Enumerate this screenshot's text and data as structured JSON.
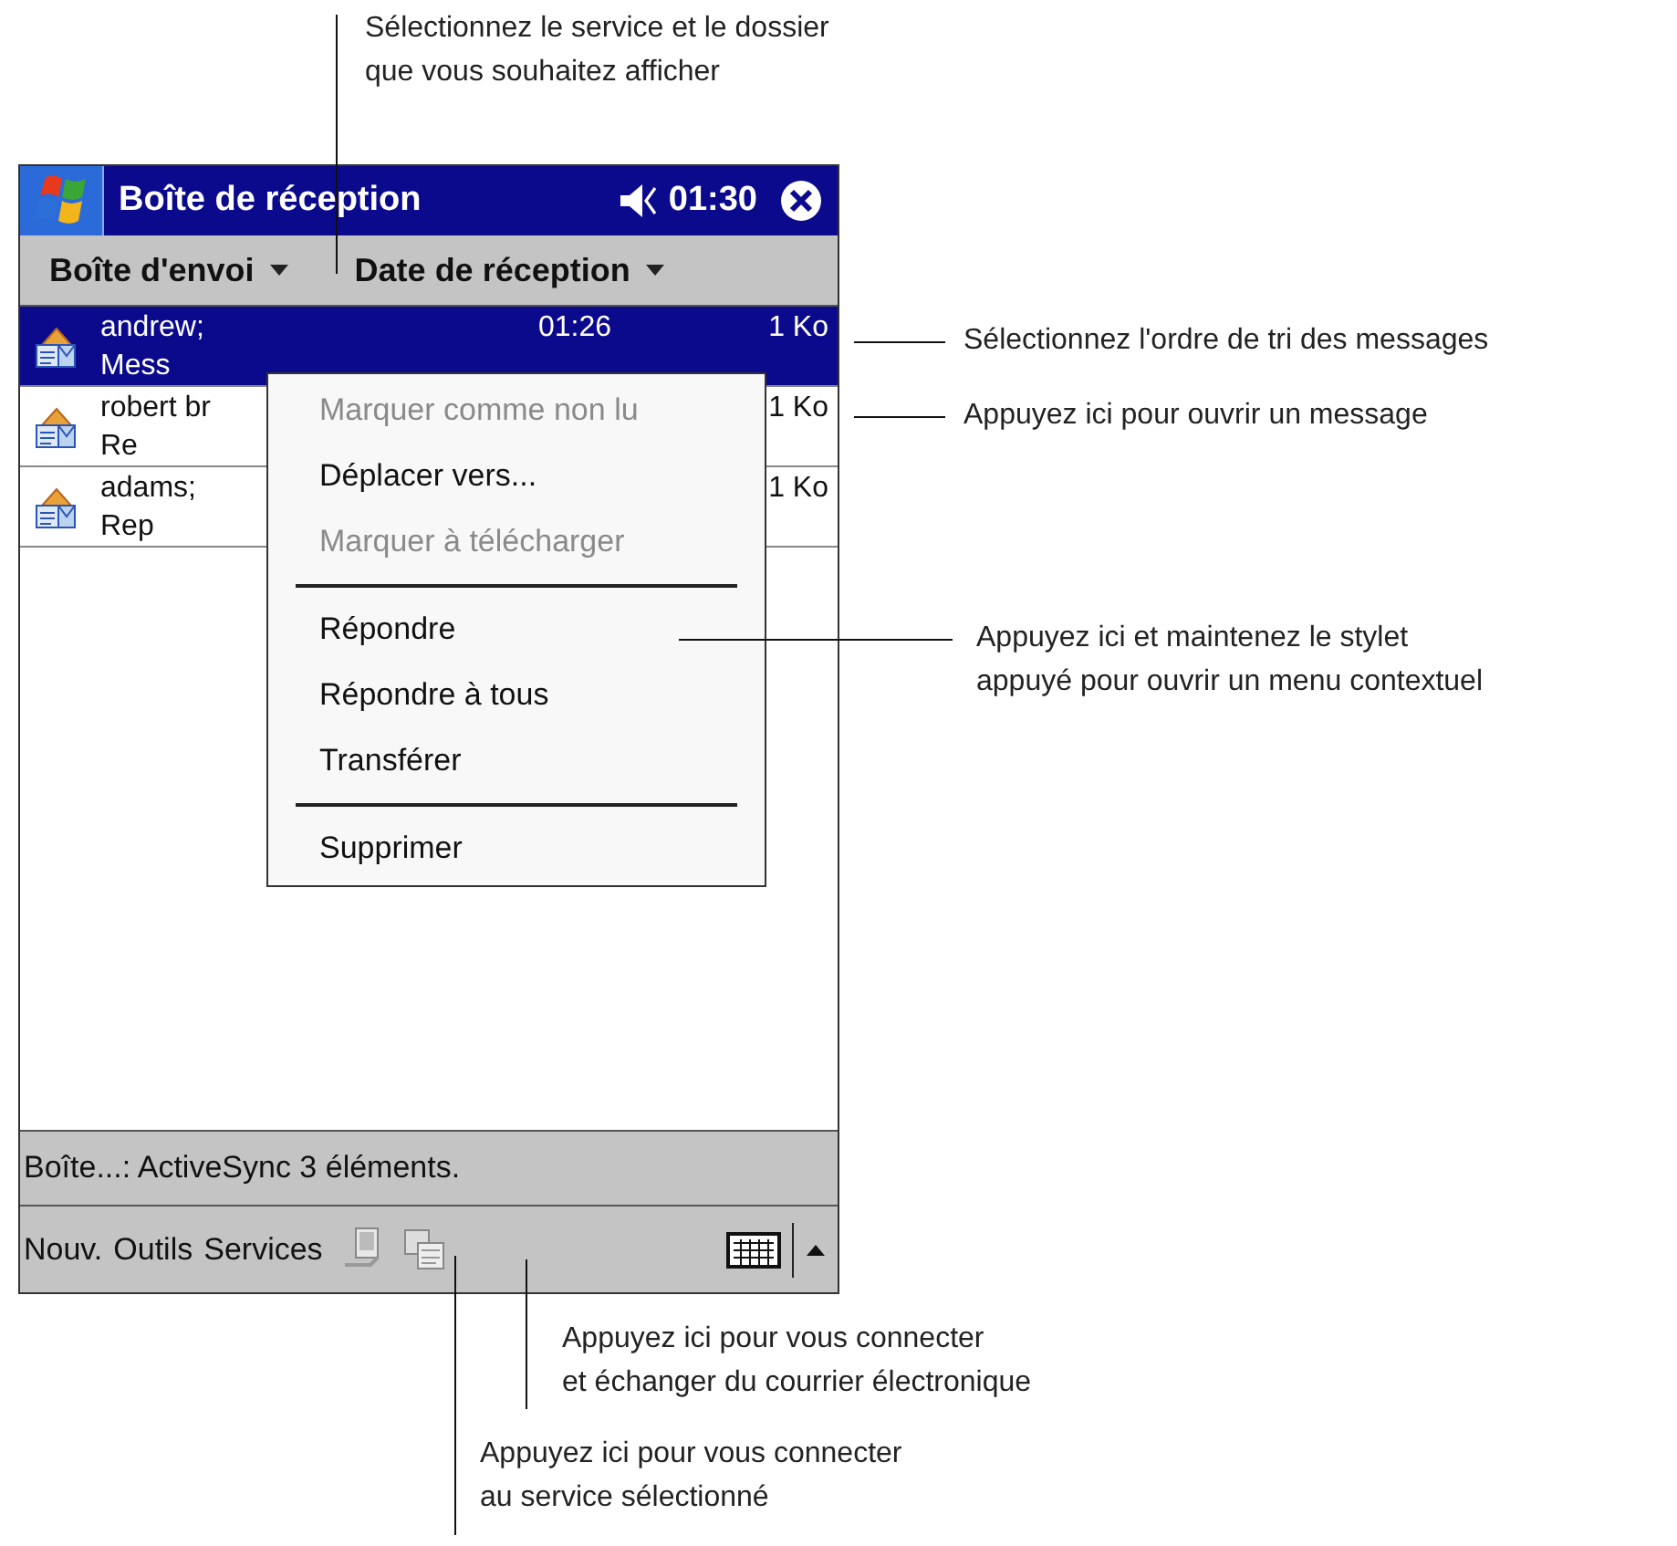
{
  "title_bar": {
    "title": "Boîte de réception",
    "time": "01:30"
  },
  "toolbar": {
    "folder": "Boîte d'envoi",
    "sort": "Date de réception"
  },
  "messages": [
    {
      "sender": "andrew;",
      "subject": "Mess",
      "time": "01:26",
      "size": "1 Ko",
      "selected": true
    },
    {
      "sender": "robert br",
      "subject": "Re",
      "size": "1 Ko",
      "selected": false
    },
    {
      "sender": "adams;",
      "subject": "Rep",
      "size": "1 Ko",
      "selected": false
    }
  ],
  "context_menu": [
    {
      "kind": "item",
      "label": "Marquer comme non lu",
      "disabled": true
    },
    {
      "kind": "item",
      "label": "Déplacer vers...",
      "disabled": false
    },
    {
      "kind": "item",
      "label": "Marquer à télécharger",
      "disabled": true
    },
    {
      "kind": "separator"
    },
    {
      "kind": "item",
      "label": "Répondre",
      "disabled": false
    },
    {
      "kind": "item",
      "label": "Répondre à tous",
      "disabled": false
    },
    {
      "kind": "item",
      "label": "Transférer",
      "disabled": false
    },
    {
      "kind": "separator"
    },
    {
      "kind": "item",
      "label": "Supprimer",
      "disabled": false
    }
  ],
  "status_bar": "Boîte...: ActiveSync  3 éléments.",
  "menu_bar": [
    "Nouv.",
    "Outils",
    "Services"
  ],
  "callouts": [
    {
      "text": "Sélectionnez le service et le dossier\nque vous souhaitez afficher"
    },
    {
      "text": "Sélectionnez l'ordre de tri des messages"
    },
    {
      "text": "Appuyez ici pour ouvrir un message"
    },
    {
      "text": "Appuyez ici et maintenez le stylet\nappuyé pour ouvrir un menu contextuel"
    },
    {
      "text": "Appuyez ici pour vous connecter\net échanger du courrier électronique"
    },
    {
      "text": "Appuyez ici pour vous connecter\nau service sélectionné"
    }
  ]
}
